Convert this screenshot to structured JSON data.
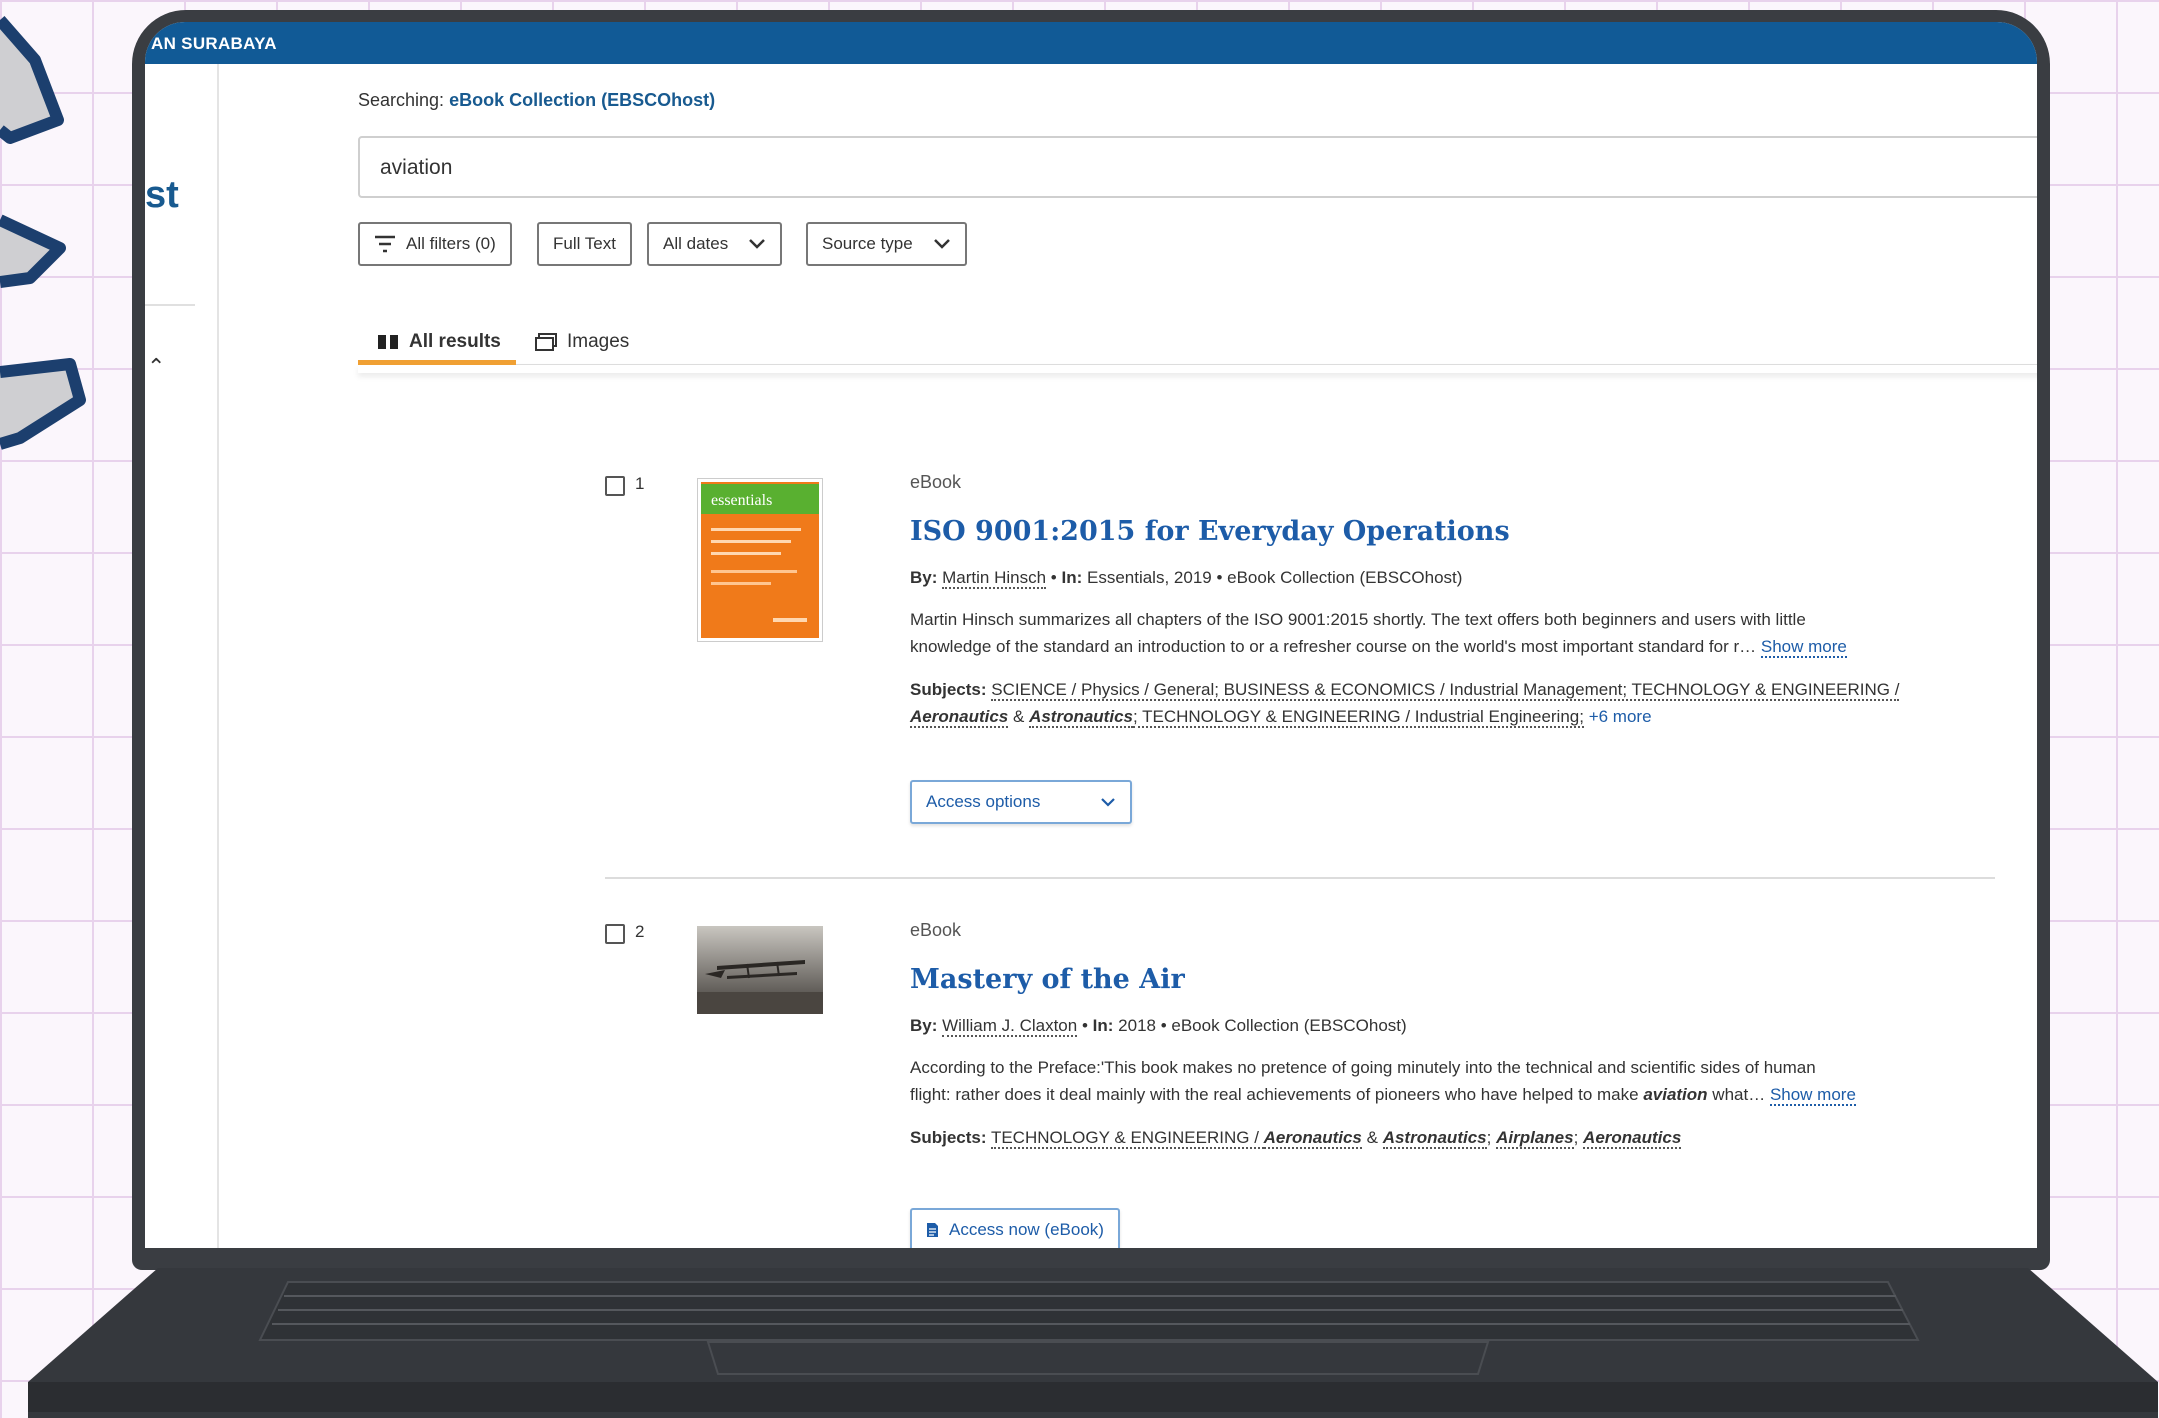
{
  "app": {
    "banner": "AN SURABAYA",
    "side_heading": "st"
  },
  "search": {
    "searching_label": "Searching:",
    "database": "eBook Collection (EBSCOhost)",
    "query": "aviation"
  },
  "filters": [
    {
      "label": "All filters (0)",
      "icon": "filter-icon"
    },
    {
      "label": "Full Text"
    },
    {
      "label": "All dates",
      "icon": "chevron-down-icon"
    },
    {
      "label": "Source type",
      "icon": "chevron-down-icon"
    }
  ],
  "tabs": [
    {
      "label": "All results",
      "icon": "book-icon",
      "active": true
    },
    {
      "label": "Images",
      "icon": "images-icon",
      "active": false
    }
  ],
  "results": [
    {
      "num": "1",
      "type": "eBook",
      "title": "ISO 9001:2015 for Everyday Operations",
      "by_label": "By:",
      "author": "Martin Hinsch",
      "in_label": "In:",
      "source": "Essentials, 2019",
      "collection": "eBook Collection (EBSCOhost)",
      "abstract_1": "Martin Hinsch summarizes all chapters of the ISO 9001:2015 shortly. The text offers both beginners and users with little",
      "abstract_2": "knowledge of the standard an introduction to or a refresher course on the world's most important standard for r…",
      "show_more": "Show more",
      "subjects_label": "Subjects:",
      "subjects_1": "SCIENCE / Physics / General; BUSINESS & ECONOMICS / Industrial Management; TECHNOLOGY & ENGINEERING /",
      "subj_a": "Aeronautics",
      "subj_amp": "&",
      "subj_b": "Astronautics",
      "subjects_2_rest": "; TECHNOLOGY & ENGINEERING / Industrial Engineering;",
      "more_subjects": "+6 more",
      "action": "Access options",
      "thumb_series": "essentials",
      "thumb_color": "#f07a1a"
    },
    {
      "num": "2",
      "type": "eBook",
      "title": "Mastery of the Air",
      "by_label": "By:",
      "author": "William J. Claxton",
      "in_label": "In:",
      "source": "2018",
      "collection": "eBook Collection (EBSCOhost)",
      "abstract_1": "According to the Preface:'This book makes no pretence of going minutely into the technical and scientific sides of human",
      "abstract_2_pre": "flight: rather does it deal mainly with the real achievements of pioneers who have helped to make ",
      "abstract_2_em": "aviation",
      "abstract_2_post": " what…",
      "show_more": "Show more",
      "subjects_label": "Subjects:",
      "subjects_pre": "TECHNOLOGY & ENGINEERING / ",
      "s_a": "Aeronautics",
      "s_amp": "&",
      "s_b": "Astronautics",
      "s_sep1": ";",
      "s_c": "Airplanes",
      "s_sep2": ";",
      "s_d": "Aeronautics",
      "action": "Access now (eBook)"
    }
  ],
  "colors": {
    "banner": "#115a96",
    "link": "#1d5ca8",
    "tab_accent": "#f0a033",
    "laptop": "#3a3d42"
  }
}
